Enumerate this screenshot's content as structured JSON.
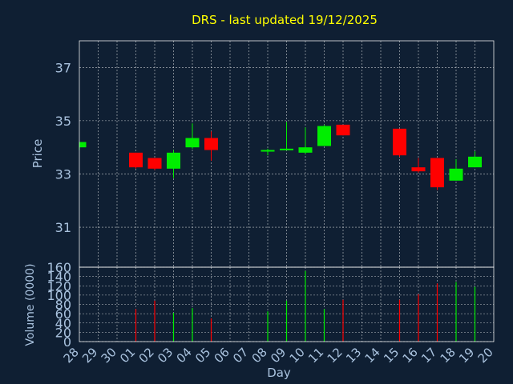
{
  "colors": {
    "up": "#00ee00",
    "down": "#ff0000",
    "background": "#0f1f33",
    "text": "#a9c2de",
    "title": "#ffff00",
    "grid": "#ffffff"
  },
  "chart_data": {
    "title": "DRS - last updated 19/12/2025",
    "xlabel": "Day",
    "price_panel": {
      "type": "candlestick",
      "ylabel": "Price",
      "ylim": [
        29.5,
        38
      ],
      "yticks": [
        "31",
        "33",
        "35",
        "37"
      ]
    },
    "volume_panel": {
      "type": "bar",
      "ylabel": "Volume (0000)",
      "ylim": [
        0,
        160
      ],
      "yticks": [
        "0",
        "20",
        "40",
        "60",
        "80",
        "100",
        "120",
        "140",
        "160"
      ]
    },
    "x": [
      "28",
      "29",
      "30",
      "01",
      "02",
      "03",
      "04",
      "05",
      "06",
      "07",
      "08",
      "09",
      "10",
      "11",
      "12",
      "13",
      "14",
      "15",
      "16",
      "17",
      "18",
      "19",
      "20"
    ],
    "candles": [
      {
        "x": "28",
        "open": 34.0,
        "high": 34.2,
        "low": 33.9,
        "close": 34.2
      },
      {
        "x": "01",
        "open": 33.8,
        "high": 33.8,
        "low": 33.2,
        "close": 33.25
      },
      {
        "x": "02",
        "open": 33.6,
        "high": 33.6,
        "low": 33.15,
        "close": 33.2
      },
      {
        "x": "03",
        "open": 33.2,
        "high": 33.9,
        "low": 32.85,
        "close": 33.8
      },
      {
        "x": "04",
        "open": 34.0,
        "high": 34.9,
        "low": 33.95,
        "close": 34.35
      },
      {
        "x": "05",
        "open": 34.35,
        "high": 34.6,
        "low": 33.5,
        "close": 33.9
      },
      {
        "x": "08",
        "open": 33.85,
        "high": 33.95,
        "low": 33.7,
        "close": 33.9
      },
      {
        "x": "09",
        "open": 33.9,
        "high": 34.95,
        "low": 33.9,
        "close": 33.95
      },
      {
        "x": "10",
        "open": 33.8,
        "high": 34.75,
        "low": 33.75,
        "close": 34.0
      },
      {
        "x": "11",
        "open": 34.05,
        "high": 34.85,
        "low": 34.05,
        "close": 34.8
      },
      {
        "x": "12",
        "open": 34.85,
        "high": 34.85,
        "low": 34.45,
        "close": 34.45
      },
      {
        "x": "15",
        "open": 34.7,
        "high": 34.7,
        "low": 33.65,
        "close": 33.7
      },
      {
        "x": "16",
        "open": 33.25,
        "high": 33.6,
        "low": 33.05,
        "close": 33.1
      },
      {
        "x": "17",
        "open": 33.6,
        "high": 33.6,
        "low": 32.4,
        "close": 32.5
      },
      {
        "x": "18",
        "open": 32.75,
        "high": 33.55,
        "low": 32.75,
        "close": 33.2
      },
      {
        "x": "19",
        "open": 33.25,
        "high": 33.85,
        "low": 33.25,
        "close": 33.65
      }
    ],
    "volume": [
      {
        "x": "01",
        "value": 70,
        "dir": "down"
      },
      {
        "x": "02",
        "value": 88,
        "dir": "down"
      },
      {
        "x": "03",
        "value": 62,
        "dir": "up"
      },
      {
        "x": "04",
        "value": 72,
        "dir": "up"
      },
      {
        "x": "05",
        "value": 50,
        "dir": "down"
      },
      {
        "x": "08",
        "value": 65,
        "dir": "up"
      },
      {
        "x": "09",
        "value": 88,
        "dir": "up"
      },
      {
        "x": "10",
        "value": 152,
        "dir": "up"
      },
      {
        "x": "11",
        "value": 70,
        "dir": "up"
      },
      {
        "x": "12",
        "value": 90,
        "dir": "down"
      },
      {
        "x": "15",
        "value": 90,
        "dir": "down"
      },
      {
        "x": "16",
        "value": 102,
        "dir": "down"
      },
      {
        "x": "17",
        "value": 125,
        "dir": "down"
      },
      {
        "x": "18",
        "value": 128,
        "dir": "up"
      },
      {
        "x": "19",
        "value": 118,
        "dir": "up"
      }
    ],
    "grid": true
  }
}
